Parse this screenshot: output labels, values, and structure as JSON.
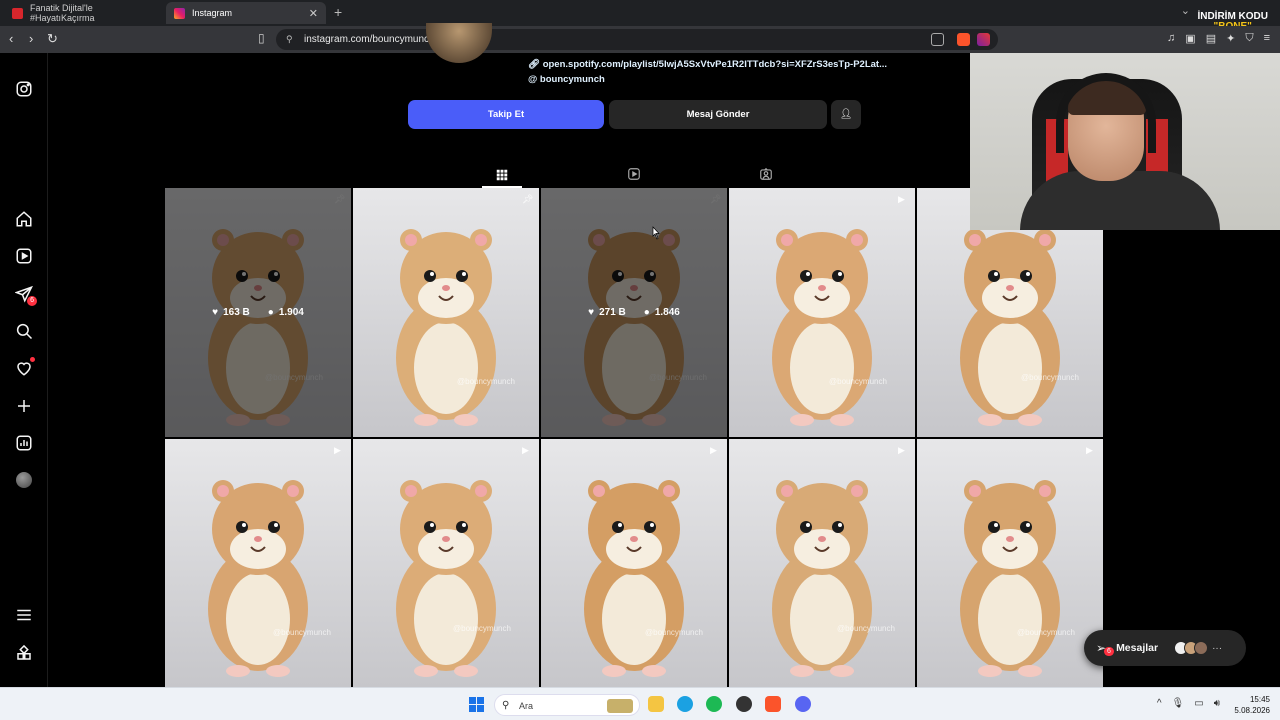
{
  "browser": {
    "tabs": [
      {
        "title": "Fanatik Dijital'le #HayatıKaçırma"
      },
      {
        "title": "Instagram"
      }
    ],
    "new_tab": "+",
    "url": "instagram.com/bouncymunch/",
    "promo_line1": "İNDİRİM KODU",
    "promo_line2": "\"BONE\""
  },
  "sidebar": {
    "messages_badge": "6"
  },
  "profile": {
    "link": "open.spotify.com/playlist/5IwjA5SxVtvPe1R2ITTdcb?si=XFZrS3esTp-P2Lat...",
    "threads_handle": "bouncymunch",
    "follow_label": "Takip Et",
    "message_label": "Mesaj Gönder"
  },
  "posts": [
    {
      "type": "pinned",
      "hover": true,
      "likes": "163 B",
      "comments": "1.904",
      "watermark": "@bouncymunch"
    },
    {
      "type": "pinned",
      "hover": false,
      "watermark": "@bouncymunch"
    },
    {
      "type": "pinned",
      "hover": true,
      "likes": "271 B",
      "comments": "1.846",
      "watermark": "@bouncymunch"
    },
    {
      "type": "reel",
      "hover": false,
      "watermark": "@bouncymunch"
    },
    {
      "type": "reel",
      "hover": false,
      "watermark": "@bouncymunch"
    },
    {
      "type": "reel",
      "hover": false,
      "watermark": "@bouncymunch"
    },
    {
      "type": "reel",
      "hover": false,
      "watermark": "@bouncymunch"
    },
    {
      "type": "reel",
      "hover": false,
      "watermark": "@bouncymunch"
    },
    {
      "type": "reel",
      "hover": false,
      "watermark": "@bouncymunch"
    },
    {
      "type": "reel",
      "hover": false,
      "watermark": "@bouncymunch"
    }
  ],
  "messages_pill": {
    "label": "Mesajlar",
    "badge": "6"
  },
  "taskbar": {
    "search_placeholder": "Ara",
    "time": "15:45",
    "date": "5.08.2026"
  }
}
